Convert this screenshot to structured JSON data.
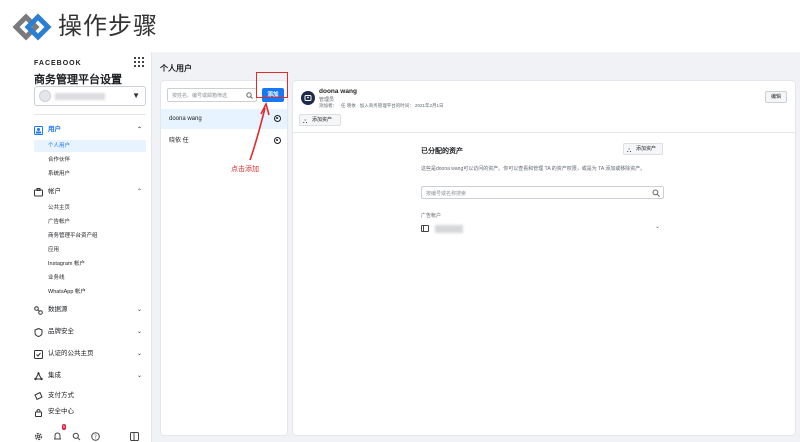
{
  "banner": {
    "title": "操作步骤"
  },
  "nav": {
    "brand": "FACEBOOK",
    "title": "商务管理平台设置",
    "sections": [
      {
        "label": "用户",
        "subitems": [
          "个人用户",
          "合作伙伴",
          "系统用户"
        ]
      },
      {
        "label": "帐户",
        "subitems": [
          "公共主页",
          "广告帐户",
          "商务管理平台资产组",
          "应用",
          "Instagram 帐户",
          "业务线",
          "WhatsApp 帐户"
        ]
      },
      {
        "label": "数据源"
      },
      {
        "label": "品牌安全"
      },
      {
        "label": "认证的公共主页"
      },
      {
        "label": "集成"
      },
      {
        "label": "支付方式"
      },
      {
        "label": "安全中心"
      }
    ],
    "notification_count": "5"
  },
  "main": {
    "title": "个人用户"
  },
  "users_panel": {
    "search_placeholder": "按姓名、编号或邮箱筛选",
    "add_label": "添加",
    "users": [
      "doona wang",
      "晓依 任"
    ]
  },
  "annotation": {
    "text": "点击添加"
  },
  "detail": {
    "name": "doona wang",
    "role": "管理员",
    "added": "添加者： · 任 晓依 · 加入商务管理平台的时间： 2021年2月1日",
    "edit_label": "编辑",
    "add_assets_label": "添加资产",
    "assigned_title": "已分配的资产",
    "assigned_add_label": "添加资产",
    "assigned_desc": "这些是doona wang可以访问的资产。你可以查看和管理 TA 的资产权限，或是为 TA 添加或移除资产。",
    "assigned_search_placeholder": "按编号或名称搜索",
    "category_label": "广告帐户"
  },
  "colors": {
    "accent": "#1877f2",
    "annotation": "#e02b2b"
  }
}
